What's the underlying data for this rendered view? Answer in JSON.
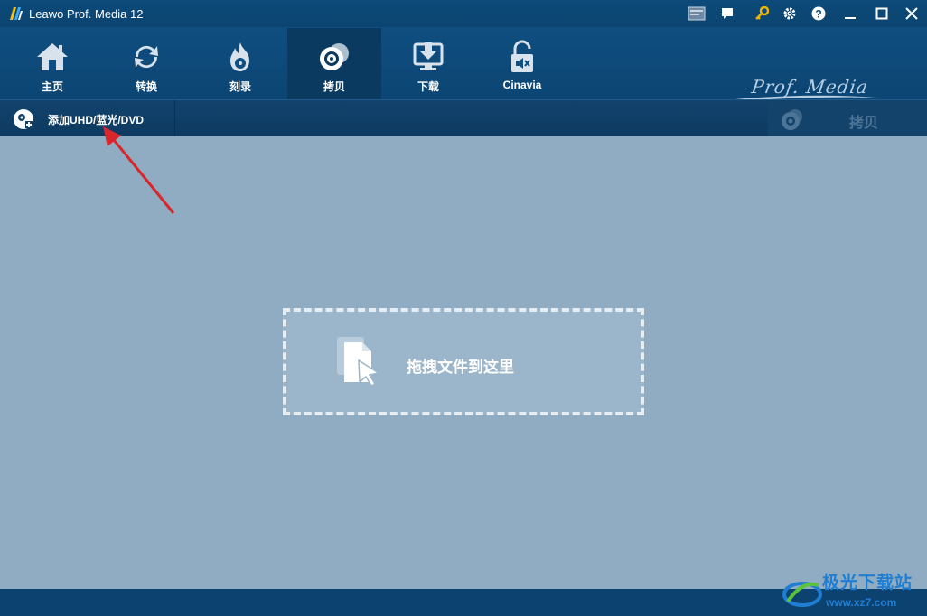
{
  "window": {
    "title": "Leawo Prof. Media 12",
    "controls": [
      "screenshot-icon",
      "chat-icon",
      "key-icon",
      "gear-icon",
      "help-icon",
      "minimize-icon",
      "maximize-icon",
      "close-icon"
    ]
  },
  "nav": {
    "items": [
      {
        "label": "主页",
        "icon": "home-icon",
        "active": false
      },
      {
        "label": "转换",
        "icon": "convert-icon",
        "active": false
      },
      {
        "label": "刻录",
        "icon": "burn-icon",
        "active": false
      },
      {
        "label": "拷贝",
        "icon": "copy-disc-icon",
        "active": true
      },
      {
        "label": "下载",
        "icon": "download-icon",
        "active": false
      },
      {
        "label": "Cinavia",
        "icon": "cinavia-unlock-icon",
        "active": false
      }
    ],
    "brand": "Prof. Media"
  },
  "toolbar": {
    "add_label": "添加UHD/蓝光/DVD",
    "copy_label": "拷贝"
  },
  "dropzone": {
    "text": "拖拽文件到这里"
  },
  "watermark": {
    "title": "极光下载站",
    "url": "www.xz7.com"
  },
  "colors": {
    "titlebar": "#0d4a7a",
    "workspace": "#8facc3",
    "active_tab": "#0a3a60",
    "annotation_arrow": "#d9262b",
    "key_icon": "#f0b400"
  }
}
